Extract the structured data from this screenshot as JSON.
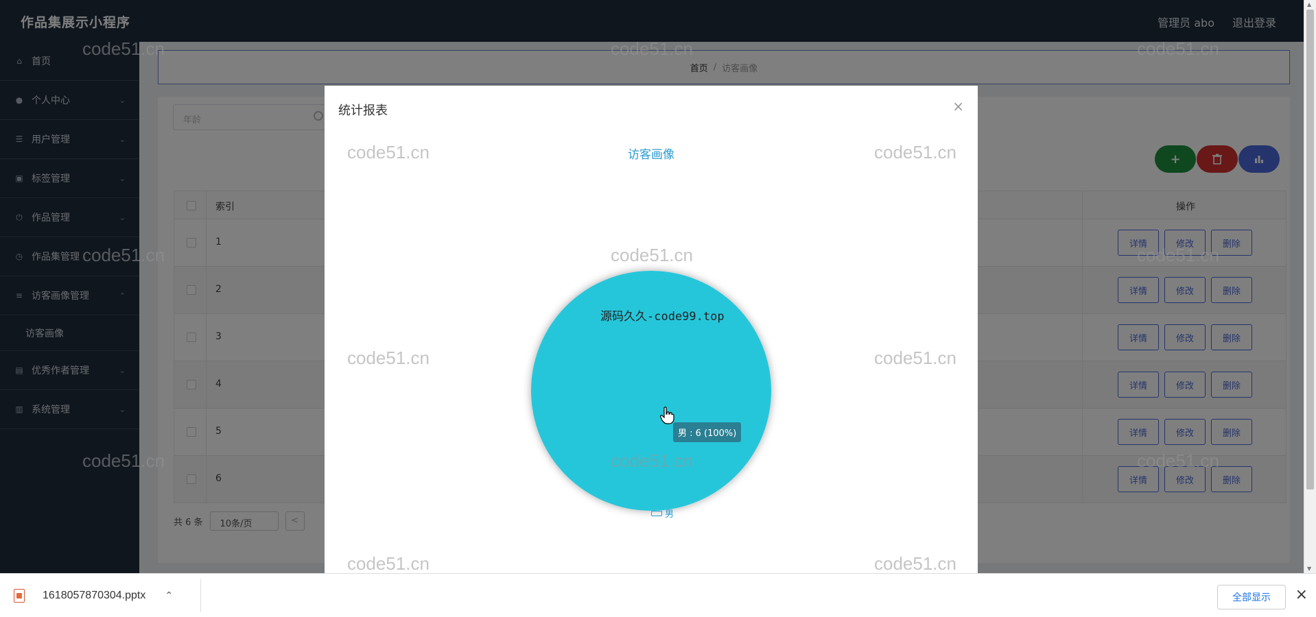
{
  "header": {
    "app_title": "作品集展示小程序",
    "admin_label": "管理员 abo",
    "logout_label": "退出登录"
  },
  "sidebar": {
    "items": [
      {
        "label": "首页",
        "icon": "home-icon"
      },
      {
        "label": "个人中心",
        "icon": "user-icon"
      },
      {
        "label": "用户管理",
        "icon": "sliders-icon"
      },
      {
        "label": "标签管理",
        "icon": "tag-icon"
      },
      {
        "label": "作品管理",
        "icon": "power-icon"
      },
      {
        "label": "作品集管理",
        "icon": "clock-icon"
      },
      {
        "label": "访客画像管理",
        "icon": "layers-icon"
      },
      {
        "label": "访客画像",
        "icon": ""
      },
      {
        "label": "优秀作者管理",
        "icon": "briefcase-icon"
      },
      {
        "label": "系统管理",
        "icon": "server-icon"
      }
    ]
  },
  "breadcrumb": {
    "home": "首页",
    "separator": "/",
    "current": "访客画像"
  },
  "search": {
    "placeholder": "年龄"
  },
  "toolbar": {
    "add": "+",
    "delete_icon": "trash-icon",
    "chart_icon": "bar-chart-icon"
  },
  "table": {
    "columns": [
      "索引",
      "操作"
    ],
    "rows": [
      {
        "index": "1"
      },
      {
        "index": "2"
      },
      {
        "index": "3"
      },
      {
        "index": "4"
      },
      {
        "index": "5"
      },
      {
        "index": "6"
      }
    ],
    "row_actions": [
      "详情",
      "修改",
      "删除"
    ]
  },
  "pagination": {
    "total": "共 6 条",
    "page_size": "10条/页",
    "prev": "<"
  },
  "dialog": {
    "title": "统计报表",
    "close": "×"
  },
  "chart_data": {
    "type": "pie",
    "title": "访客画像",
    "slices": [
      {
        "name": "男",
        "value": 6,
        "percent": 100,
        "color": "#26c6da"
      }
    ],
    "tooltip": "男 : 6 (100%)",
    "legend": [
      "男"
    ]
  },
  "overlay_text": "源码久久-code99.top",
  "watermark": "code51.cn",
  "downloads": {
    "filename": "1618057870304.pptx",
    "show_all": "全部显示",
    "close": "×"
  }
}
